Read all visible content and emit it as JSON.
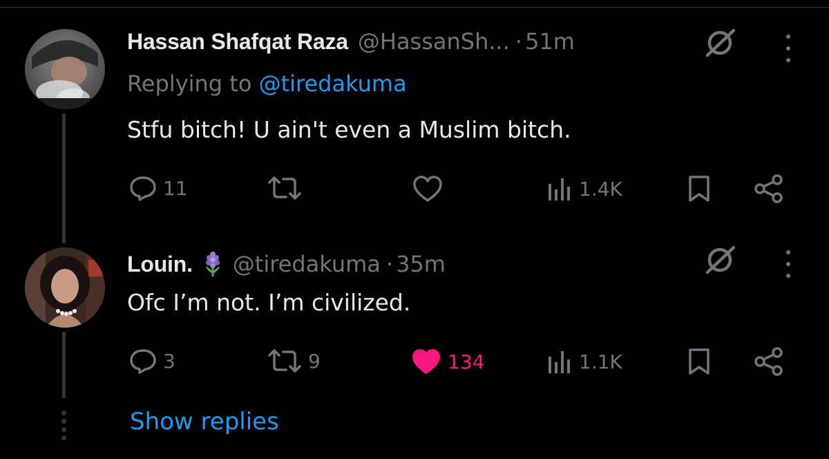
{
  "tweets": [
    {
      "display_name": "Hassan Shafqat Raza",
      "handle": "@HassanSh...",
      "separator": "·",
      "time": "51m",
      "replying_prefix": "Replying to",
      "replying_to": "@tiredakuma",
      "text": "Stfu bitch! U ain't even a Muslim bitch.",
      "replies": "11",
      "retweets": "",
      "likes": "",
      "views": "1.4K",
      "liked": false
    },
    {
      "display_name": "Louin.",
      "emoji": "hyacinth-flower-icon",
      "handle": "@tiredakuma",
      "separator": "·",
      "time": "35m",
      "text": "Ofc I’m not. I’m civilized.",
      "replies": "3",
      "retweets": "9",
      "likes": "134",
      "views": "1.1K",
      "liked": true
    }
  ],
  "show_replies": "Show replies",
  "colors": {
    "background": "#000000",
    "text": "#e7e9ea",
    "muted": "#71767b",
    "link": "#1d9bf0",
    "like": "#f91880",
    "thread_line": "#333639"
  }
}
